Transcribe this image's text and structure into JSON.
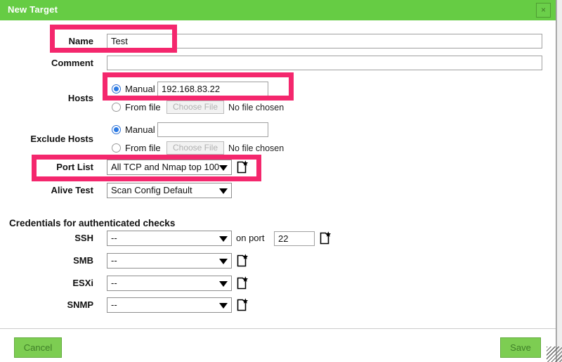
{
  "window": {
    "title": "New Target",
    "close_label": "×",
    "accent_green": "#66cc44",
    "annotation_pink": "#f4276d"
  },
  "form": {
    "name": {
      "label": "Name",
      "value": "Test",
      "placeholder": ""
    },
    "comment": {
      "label": "Comment",
      "value": "",
      "placeholder": ""
    },
    "hosts": {
      "label": "Hosts",
      "manual_label": "Manual",
      "manual_value": "192.168.83.22",
      "from_file_label": "From file",
      "choose_file_label": "Choose File",
      "no_file_label": "No file chosen",
      "selected": "manual"
    },
    "exclude_hosts": {
      "label": "Exclude Hosts",
      "manual_label": "Manual",
      "manual_value": "",
      "from_file_label": "From file",
      "choose_file_label": "Choose File",
      "no_file_label": "No file chosen",
      "selected": "manual"
    },
    "port_list": {
      "label": "Port List",
      "value": "All TCP and Nmap top 100",
      "new_icon": "new-document-star-icon"
    },
    "alive_test": {
      "label": "Alive Test",
      "value": "Scan Config Default"
    }
  },
  "credentials": {
    "heading": "Credentials for authenticated checks",
    "rows": [
      {
        "label": "SSH",
        "value": "--",
        "on_port_label": "on port",
        "port_value": "22",
        "new_icon": "new-document-star-icon"
      },
      {
        "label": "SMB",
        "value": "--",
        "new_icon": "new-document-star-icon"
      },
      {
        "label": "ESXi",
        "value": "--",
        "new_icon": "new-document-star-icon"
      },
      {
        "label": "SNMP",
        "value": "--",
        "new_icon": "new-document-star-icon"
      }
    ]
  },
  "footer": {
    "cancel_label": "Cancel",
    "save_label": "Save"
  },
  "annotations": [
    {
      "name": "name-field-highlight"
    },
    {
      "name": "hosts-manual-highlight"
    },
    {
      "name": "port-list-highlight"
    }
  ]
}
